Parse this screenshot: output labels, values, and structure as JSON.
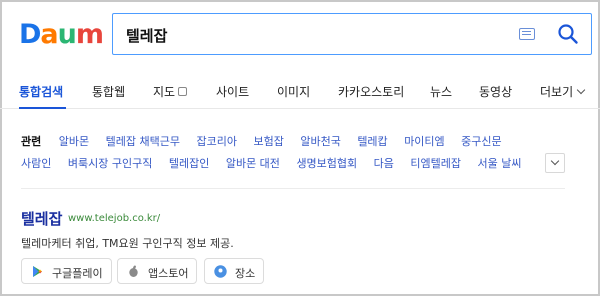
{
  "header": {
    "logo_letters": [
      "D",
      "a",
      "u",
      "m"
    ],
    "search_value": "텔레잡",
    "keyboard_icon": "keyboard-icon",
    "search_icon": "search-icon"
  },
  "tabs": [
    {
      "label": "통합검색",
      "active": true
    },
    {
      "label": "통합웹"
    },
    {
      "label": "지도"
    },
    {
      "label": "사이트"
    },
    {
      "label": "이미지"
    },
    {
      "label": "카카오스토리"
    },
    {
      "label": "뉴스"
    },
    {
      "label": "동영상"
    },
    {
      "label": "더보기"
    }
  ],
  "related": {
    "title": "관련",
    "row1": [
      "알바몬",
      "텔레잡 채택근무",
      "잡코리아",
      "보험잡",
      "알바천국",
      "텔레캅",
      "마이티엠",
      "중구신문"
    ],
    "row2": [
      "사람인",
      "벼룩시장 구인구직",
      "텔레잡인",
      "알바몬 대전",
      "생명보험협회",
      "다음",
      "티엠텔레잡",
      "서울 날씨"
    ]
  },
  "result": {
    "title": "텔레잡",
    "url": "www.telejob.co.kr/",
    "description": "텔레마케터 취업, TM요원 구인구직 정보 제공.",
    "chips": [
      {
        "label": "구글플레이",
        "icon": "google-play-icon"
      },
      {
        "label": "앱스토어",
        "icon": "apple-icon"
      },
      {
        "label": "장소",
        "icon": "map-pin-icon"
      }
    ]
  },
  "colors": {
    "accent": "#1a55d8",
    "link": "#3558c5",
    "url": "#3b8a3b",
    "search_border": "#4d9cff"
  }
}
